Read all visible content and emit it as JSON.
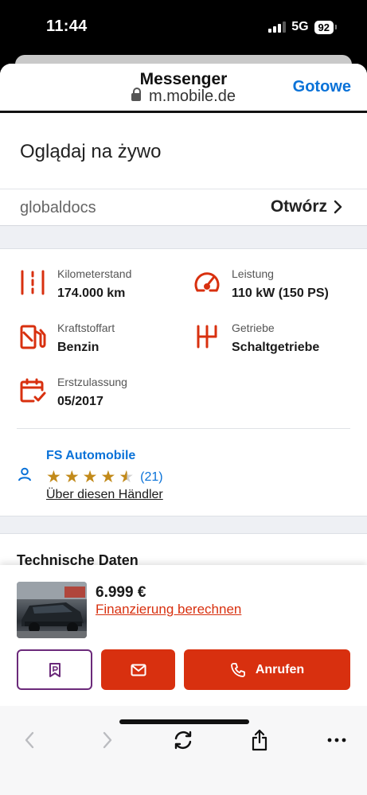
{
  "status": {
    "time": "11:44",
    "network": "5G",
    "battery": "92"
  },
  "nav": {
    "title": "Messenger",
    "url": "m.mobile.de",
    "done_label": "Gotowe"
  },
  "live": {
    "title": "Oglądaj na żywo",
    "source": "globaldocs",
    "open_label": "Otwórz"
  },
  "specs": [
    {
      "icon": "odometer-icon",
      "label": "Kilometerstand",
      "value": "174.000 km"
    },
    {
      "icon": "speedometer-icon",
      "label": "Leistung",
      "value": "110 kW (150 PS)"
    },
    {
      "icon": "fuel-pump-icon",
      "label": "Kraftstoffart",
      "value": "Benzin"
    },
    {
      "icon": "gearbox-icon",
      "label": "Getriebe",
      "value": "Schaltgetriebe"
    },
    {
      "icon": "calendar-check-icon",
      "label": "Erstzulassung",
      "value": "05/2017"
    }
  ],
  "dealer": {
    "name": "FS Automobile",
    "rating": 4.5,
    "rating_count": "(21)",
    "about_link": "Über diesen Händler"
  },
  "tech": {
    "title": "Technische Daten"
  },
  "buy": {
    "price": "6.999 €",
    "finance_link": "Finanzierung berechnen",
    "call_label": "Anrufen"
  },
  "colors": {
    "accent": "#d8300f",
    "link": "#0a72d8",
    "park_border": "#6b2a7a",
    "star": "#c28a1a"
  }
}
